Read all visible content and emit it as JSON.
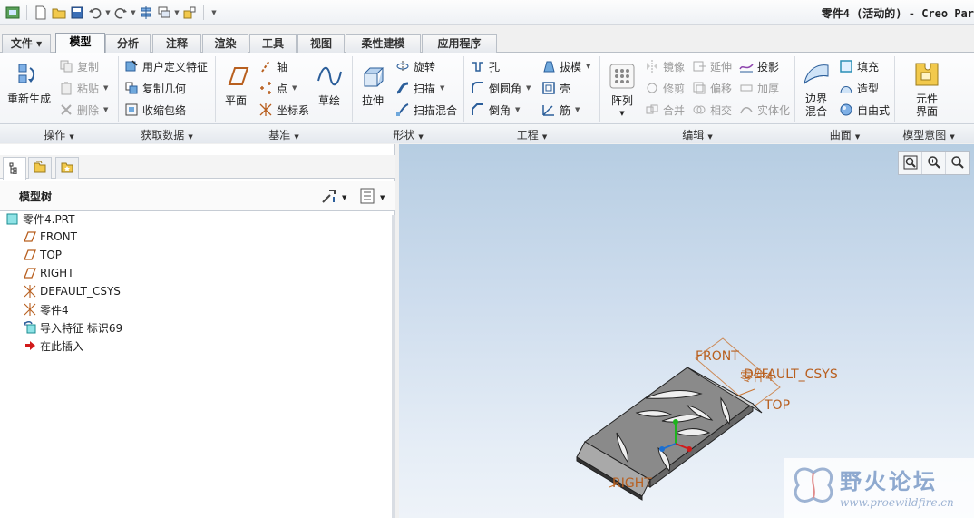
{
  "window": {
    "title": "零件4 (活动的) - Creo Par"
  },
  "quick_access": {
    "icons": [
      "app-icon",
      "new-icon",
      "open-icon",
      "save-icon",
      "undo-icon",
      "redo-icon",
      "regenerate-icon",
      "windows-icon",
      "close-window-icon",
      "customize-icon"
    ]
  },
  "tabs": [
    {
      "label": "文件"
    },
    {
      "label": "模型"
    },
    {
      "label": "分析"
    },
    {
      "label": "注释"
    },
    {
      "label": "渲染"
    },
    {
      "label": "工具"
    },
    {
      "label": "视图"
    },
    {
      "label": "柔性建模"
    },
    {
      "label": "应用程序"
    }
  ],
  "ribbon": {
    "operations": {
      "regenerate": "重新生成",
      "copy": "复制",
      "paste": "粘贴",
      "delete": "删除",
      "group": "操作"
    },
    "get_data": {
      "udf": "用户定义特征",
      "copy_geom": "复制几何",
      "shrinkwrap": "收缩包络",
      "group": "获取数据"
    },
    "datum": {
      "plane": "平面",
      "axis": "轴",
      "point": "点",
      "csys": "坐标系",
      "sketch": "草绘",
      "group": "基准"
    },
    "shapes": {
      "extrude": "拉伸",
      "revolve": "旋转",
      "sweep": "扫描",
      "swept_blend": "扫描混合",
      "group": "形状"
    },
    "engineering": {
      "hole": "孔",
      "round": "倒圆角",
      "chamfer": "倒角",
      "draft": "拔模",
      "shell": "壳",
      "rib": "筋",
      "group": "工程"
    },
    "editing": {
      "pattern": "阵列",
      "mirror": "镜像",
      "trim": "修剪",
      "merge": "合并",
      "extend": "延伸",
      "offset": "偏移",
      "intersect": "相交",
      "project": "投影",
      "thicken": "加厚",
      "solidify": "实体化",
      "group": "编辑"
    },
    "surfaces": {
      "boundary_blend": "边界\n混合",
      "fill": "填充",
      "style": "造型",
      "freestyle": "自由式",
      "group": "曲面"
    },
    "model_intent": {
      "component_interface": "元件\n界面",
      "group": "模型意图"
    }
  },
  "model_tree": {
    "title": "模型树",
    "items": [
      {
        "label": "零件4.PRT",
        "icon": "part-icon"
      },
      {
        "label": "FRONT",
        "icon": "datum-plane-icon"
      },
      {
        "label": "TOP",
        "icon": "datum-plane-icon"
      },
      {
        "label": "RIGHT",
        "icon": "datum-plane-icon"
      },
      {
        "label": "DEFAULT_CSYS",
        "icon": "csys-icon"
      },
      {
        "label": "零件4",
        "icon": "csys-icon"
      },
      {
        "label": "导入特征 标识69",
        "icon": "import-feature-icon"
      },
      {
        "label": "在此插入",
        "icon": "insert-here-icon"
      }
    ]
  },
  "viewport": {
    "labels": {
      "front": "FRONT",
      "csys": "DEFAULT_CSYS",
      "csys_overlap": "零件4",
      "top": "TOP",
      "right": "RIGHT"
    }
  },
  "watermark": {
    "title": "野火论坛",
    "url": "www.proewildfire.cn"
  },
  "colors": {
    "datum": "#b85f1f",
    "model": "#3e3e3e"
  }
}
